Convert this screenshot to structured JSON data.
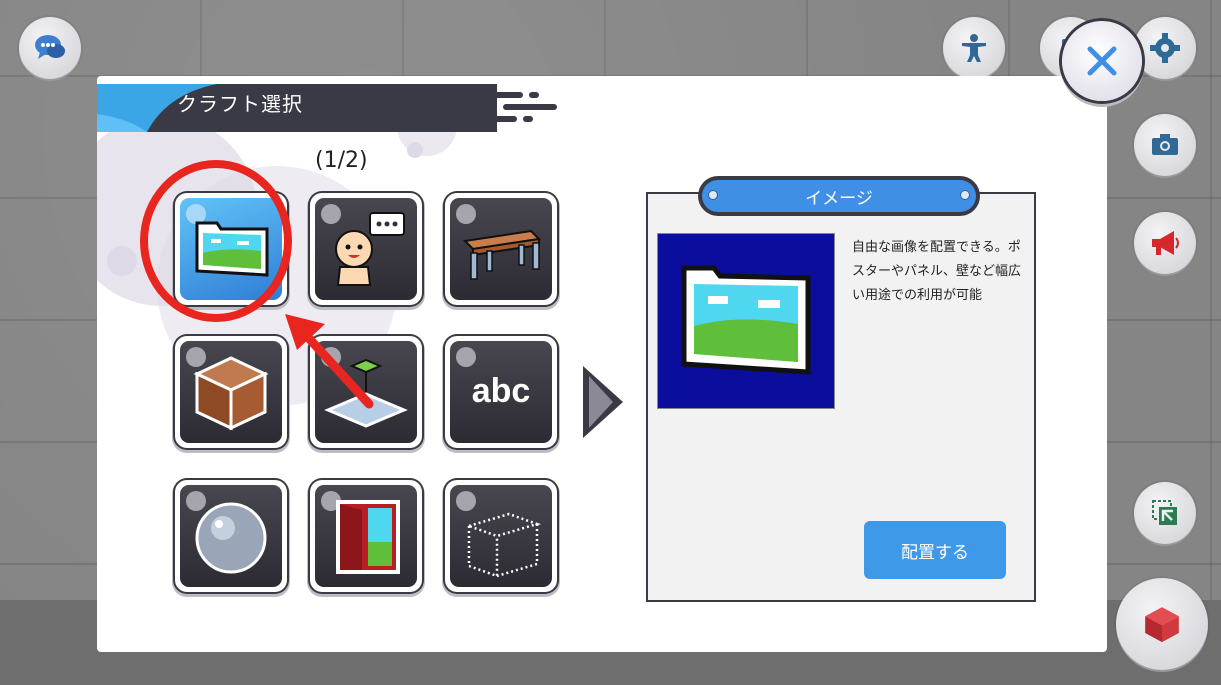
{
  "dialog": {
    "title": "クラフト選択",
    "page_indicator": "(1/2)"
  },
  "craft_items": [
    {
      "name": "image",
      "selected": true
    },
    {
      "name": "character"
    },
    {
      "name": "table"
    },
    {
      "name": "brick-block"
    },
    {
      "name": "ground-area"
    },
    {
      "name": "text-abc",
      "label": "abc"
    },
    {
      "name": "sphere"
    },
    {
      "name": "door"
    },
    {
      "name": "transparent-box"
    }
  ],
  "detail": {
    "tag": "イメージ",
    "description": "自由な画像を配置できる。ポスターやパネル、壁など幅広い用途での利用が可能",
    "place_button": "配置する"
  },
  "side_buttons": [
    "chat-icon",
    "person-icon",
    "book-icon",
    "gear-icon",
    "camera-icon",
    "megaphone-icon",
    "move-out-icon",
    "cube-icon"
  ],
  "colors": {
    "accent_blue": "#3e99e8",
    "highlight_red": "#e8261f",
    "dark": "#3a3a44"
  }
}
